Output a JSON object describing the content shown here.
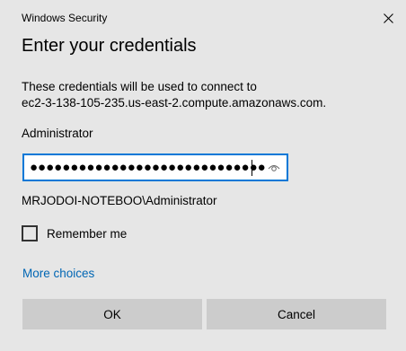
{
  "window": {
    "title": "Windows Security",
    "close_icon": "close-icon"
  },
  "dialog": {
    "heading": "Enter your credentials",
    "description_line1": "These credentials will be used to connect to",
    "description_line2": "ec2-3-138-105-235.us-east-2.compute.amazonaws.com.",
    "username": "Administrator",
    "password_masked": "●●●●●●●●●●●●●●●●●●●●●●●●●●●●●",
    "reveal_icon": "eye-icon",
    "domain_user": "MRJODOI-NOTEBOO\\Administrator",
    "remember_label": "Remember me",
    "remember_checked": false,
    "more_choices": "More choices",
    "ok_label": "OK",
    "cancel_label": "Cancel"
  },
  "colors": {
    "background": "#e6e6e6",
    "accent": "#0078d7",
    "link": "#0066b4",
    "button": "#cccccc"
  }
}
